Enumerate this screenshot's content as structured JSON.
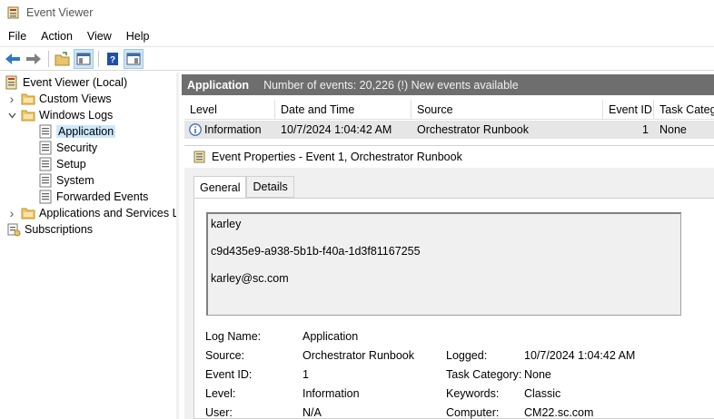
{
  "window": {
    "title": "Event Viewer"
  },
  "menu": [
    "File",
    "Action",
    "View",
    "Help"
  ],
  "toolbar": {
    "buttons": [
      "back-arrow-icon",
      "forward-arrow-icon",
      "open-folder-icon",
      "show-hide-tree-icon",
      "help-icon",
      "show-hide-action-pane-icon"
    ]
  },
  "tree": {
    "items": [
      {
        "label": "Event Viewer (Local)",
        "icon": "event-viewer-icon",
        "level": 0,
        "expander": "collapse"
      },
      {
        "label": "Custom Views",
        "icon": "folder-icon",
        "level": 1,
        "expander": "expand"
      },
      {
        "label": "Windows Logs",
        "icon": "folder-icon",
        "level": 1,
        "expander": "collapse"
      },
      {
        "label": "Application",
        "icon": "log-icon",
        "level": 2,
        "expander": "none",
        "selected": true
      },
      {
        "label": "Security",
        "icon": "log-icon",
        "level": 2,
        "expander": "none"
      },
      {
        "label": "Setup",
        "icon": "log-icon",
        "level": 2,
        "expander": "none"
      },
      {
        "label": "System",
        "icon": "log-icon",
        "level": 2,
        "expander": "none"
      },
      {
        "label": "Forwarded Events",
        "icon": "log-icon",
        "level": 2,
        "expander": "none"
      },
      {
        "label": "Applications and Services Lo",
        "icon": "folder-icon",
        "level": 1,
        "expander": "expand"
      },
      {
        "label": "Subscriptions",
        "icon": "subscriptions-icon",
        "level": 1,
        "expander": "none"
      }
    ]
  },
  "header": {
    "log_name": "Application",
    "summary": "Number of events: 20,226 (!) New events available"
  },
  "grid": {
    "columns": [
      "Level",
      "Date and Time",
      "Source",
      "Event ID",
      "Task Categor"
    ],
    "rows": [
      {
        "level": "Information",
        "date": "10/7/2024 1:04:42 AM",
        "source": "Orchestrator Runbook",
        "event_id": "1",
        "task": "None"
      }
    ]
  },
  "properties": {
    "title": "Event Properties - Event 1, Orchestrator Runbook",
    "tabs": [
      "General",
      "Details"
    ],
    "description_lines": [
      "karley",
      "c9d435e9-a938-5b1b-f40a-1d3f81167255",
      "karley@sc.com"
    ],
    "fields": {
      "log_name_label": "Log Name:",
      "log_name": "Application",
      "source_label": "Source:",
      "source": "Orchestrator Runbook",
      "logged_label": "Logged:",
      "logged": "10/7/2024 1:04:42 AM",
      "event_id_label": "Event ID:",
      "event_id": "1",
      "task_category_label": "Task Category:",
      "task_category": "None",
      "level_label": "Level:",
      "level": "Information",
      "keywords_label": "Keywords:",
      "keywords": "Classic",
      "user_label": "User:",
      "user": "N/A",
      "computer_label": "Computer:",
      "computer": "CM22.sc.com"
    }
  }
}
